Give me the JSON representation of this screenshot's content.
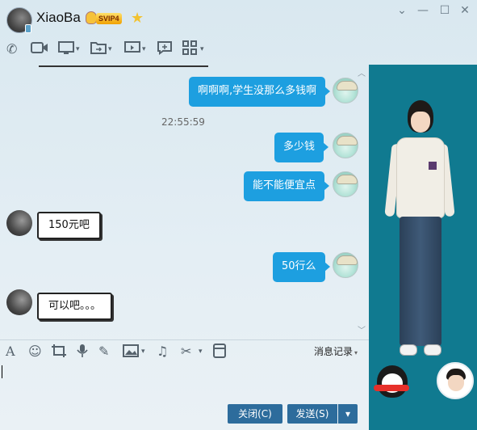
{
  "window": {
    "contact_name": "XiaoBa",
    "svip_badge": "SVIP4",
    "window_buttons": [
      "chevron-down-icon",
      "minimize-icon",
      "maximize-icon",
      "close-icon"
    ]
  },
  "toolbar": {
    "icons": [
      "phone-icon",
      "video-icon",
      "screen-share-icon",
      "file-transfer-icon",
      "remote-assist-icon",
      "chat-app-icon",
      "apps-grid-icon"
    ]
  },
  "messages": [
    {
      "side": "right",
      "text": "啊啊啊,学生没那么多钱啊"
    },
    {
      "side": "timestamp",
      "text": "22:55:59"
    },
    {
      "side": "right",
      "text": "多少钱"
    },
    {
      "side": "right",
      "text": "能不能便宜点"
    },
    {
      "side": "left",
      "text": "150元吧"
    },
    {
      "side": "right",
      "text": "50行么"
    },
    {
      "side": "left",
      "text": "可以吧。。。"
    }
  ],
  "input_toolbar": {
    "icons": [
      "font-icon",
      "emoji-icon",
      "screenshot-icon",
      "voice-icon",
      "handwrite-icon",
      "image-icon",
      "music-icon",
      "scissors-icon",
      "red-packet-icon"
    ],
    "history_label": "消息记录"
  },
  "buttons": {
    "close_label": "关闭(C)",
    "send_label": "发送(S)"
  },
  "colors": {
    "bubble_blue": "#1d9fe0",
    "show_panel": "#107a90",
    "button": "#2d6c9c"
  }
}
